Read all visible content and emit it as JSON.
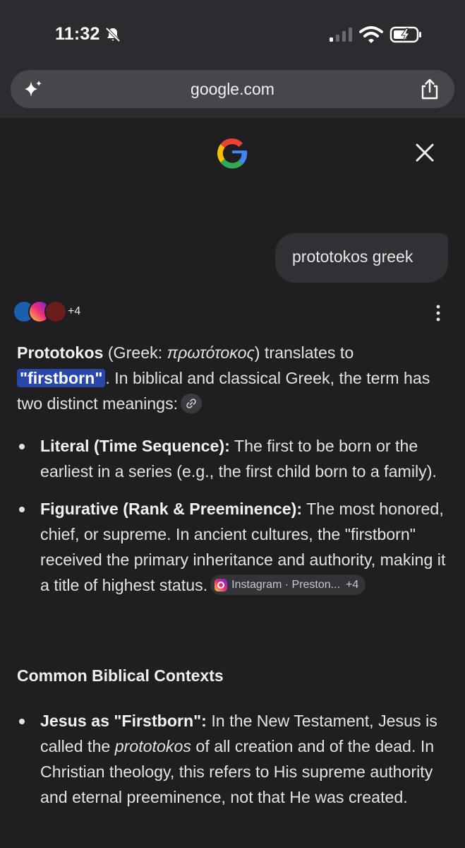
{
  "status_bar": {
    "time": "11:32"
  },
  "browser": {
    "url": "google.com"
  },
  "query": "prototokos greek",
  "sources": {
    "more_count": "+4"
  },
  "answer": {
    "intro": {
      "term": "Prototokos",
      "greek_open": " (Greek: ",
      "greek_word": "πρωτότοκος",
      "greek_close": ") translates to ",
      "highlight": "\"firstborn\"",
      "rest": ". In biblical and classical Greek, the term has two distinct meanings:"
    },
    "meanings": [
      {
        "label": "Literal (Time Sequence):",
        "text": " The first to be born or the earliest in a series (e.g., the first child born to a family)."
      },
      {
        "label": "Figurative (Rank & Preeminence):",
        "text": " The most honored, chief, or supreme. In ancient cultures, the \"firstborn\" received the primary inheritance and authority, making it a title of highest status.",
        "citation": {
          "source": "Instagram · Preston...",
          "more": "+4"
        }
      }
    ],
    "section_title": "Common Biblical Contexts",
    "contexts": [
      {
        "label": "Jesus as \"Firstborn\":",
        "text_before": " In the New Testament, Jesus is called the ",
        "italic": "prototokos",
        "text_after": " of all creation and of the dead. In Christian theology, this refers to His supreme authority and eternal preeminence, not that He was created."
      }
    ]
  },
  "colors": {
    "background": "#1f1f21",
    "chrome": "#2b2c2f",
    "highlight": "#2947a8",
    "bubble": "#303134"
  }
}
